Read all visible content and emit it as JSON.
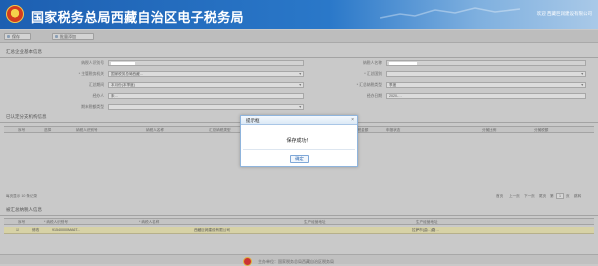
{
  "header": {
    "title": "国家税务总局西藏自治区电子税务局",
    "welcome": "欢迎 西藏巨润建设有限公司"
  },
  "toolbar": {
    "save": "保存",
    "batch_import": "批量添加"
  },
  "basic_info": {
    "title": "汇总企业基本信息",
    "fields": [
      {
        "label": "纳税人识别号",
        "value": "",
        "masked": true
      },
      {
        "label": "纳税人名称",
        "value": "",
        "masked": true
      },
      {
        "label": "* 主管税务机关",
        "value": "国家税务总局西藏...",
        "dropdown": true
      },
      {
        "label": "* 汇总国别",
        "value": "",
        "dropdown": true
      },
      {
        "label": "汇总期间",
        "value": "本月份(本季度)",
        "dropdown": true
      },
      {
        "label": "* 汇总纳税类型",
        "value": "季度",
        "dropdown": true
      },
      {
        "label": "经办人",
        "value": "朱…"
      },
      {
        "label": "经办日期",
        "value": "2020-…"
      },
      {
        "label": "期末税额类型",
        "value": "",
        "dropdown": true
      }
    ]
  },
  "branches": {
    "title": "已认定分支机构信息",
    "columns": [
      "序号",
      "选择",
      "纳税人识别号",
      "纳税人名称",
      "汇总纳税类型",
      "主管税务机关",
      "税务局",
      "总税金额",
      "申报状态",
      "分摊比例",
      "分摊税额"
    ]
  },
  "pager": {
    "record_text": "每页显示 10 条记录",
    "first": "首页",
    "prev": "上一页",
    "next": "下一页",
    "last": "尾页",
    "page_prefix": "第",
    "page_value": "1",
    "page_suffix": "页",
    "go": "跳转"
  },
  "summary": {
    "title": "被汇总纳税人信息",
    "columns": [
      "序号",
      "* 纳税人识别号",
      "* 纳税人名称",
      "生产经营地址"
    ],
    "rows": [
      {
        "col1": "修改",
        "id": "91540000MA6T...",
        "name": "西藏巨润建设有限公司",
        "addr": "拉萨市(曲...)路…"
      }
    ]
  },
  "footer": {
    "text": "主办单位：国家税务总局西藏自治区税务局"
  },
  "dialog": {
    "title": "提示框",
    "close": "×",
    "message": "保存成功！",
    "ok": "确定"
  },
  "colors": {
    "banner": "#2a78c9",
    "row_highlight": "#d7d2a6",
    "dialog_border": "#8fb4dc",
    "ok_text": "#1f5da8"
  }
}
